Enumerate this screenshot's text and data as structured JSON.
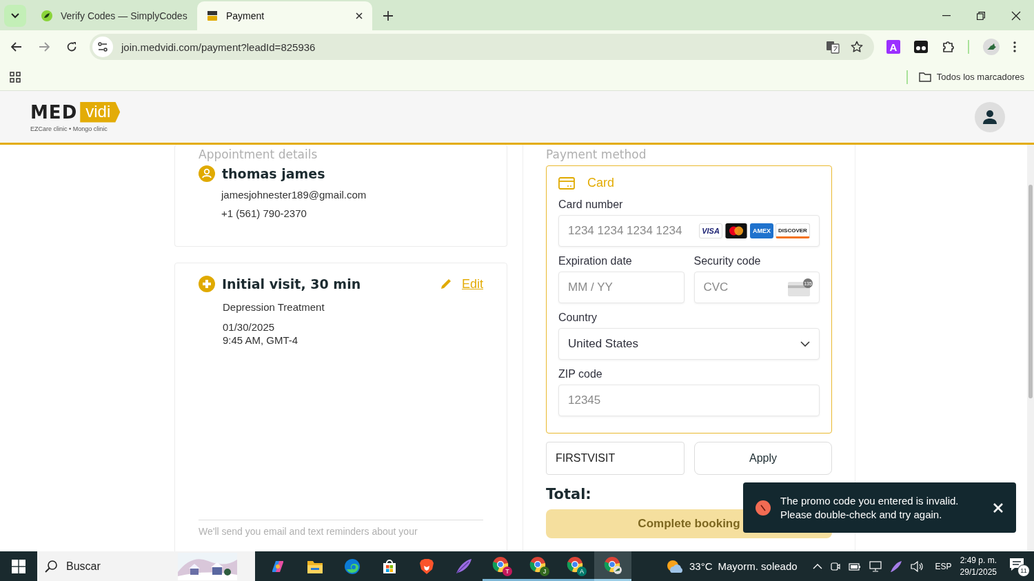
{
  "browser": {
    "tabs": [
      {
        "title": "Verify Codes — SimplyCodes",
        "kind": "simplycodes",
        "selected": false
      },
      {
        "title": "Payment",
        "kind": "medvidi",
        "selected": true
      }
    ],
    "url": "join.medvidi.com/payment?leadId=825936",
    "extension_label": "A",
    "bookmarks_label": "Todos los marcadores"
  },
  "site": {
    "logo_left": "MED",
    "logo_right": "vidi",
    "tagline": "EZCare clinic • Mongo clinic"
  },
  "appointment": {
    "heading": "Appointment details",
    "patient": {
      "name": "thomas james",
      "email": "jamesjohnester189@gmail.com",
      "phone": "+1 (561) 790-2370"
    },
    "visit": {
      "title": "Initial visit, 30 min",
      "edit_label": "Edit",
      "service": "Depression Treatment",
      "date": "01/30/2025",
      "time": "9:45 AM, GMT-4"
    },
    "reminder": "We'll send you email and text reminders about your"
  },
  "payment": {
    "heading": "Payment method",
    "method": {
      "label": "Card",
      "selected": true
    },
    "card_number": {
      "label": "Card number",
      "placeholder": "1234 1234 1234 1234"
    },
    "card_brands": [
      {
        "kind": "visa",
        "label": "VISA"
      },
      {
        "kind": "mastercard"
      },
      {
        "kind": "amex",
        "label": "AMEX"
      },
      {
        "kind": "discover",
        "label": "DISCOVER"
      }
    ],
    "expiration": {
      "label": "Expiration date",
      "placeholder": "MM / YY"
    },
    "security": {
      "label": "Security code",
      "placeholder": "CVC",
      "card_hint": "135"
    },
    "country": {
      "label": "Country",
      "value": "United States"
    },
    "zip": {
      "label": "ZIP code",
      "placeholder": "12345"
    },
    "promo": {
      "value": "FIRSTVISIT",
      "apply_label": "Apply"
    },
    "total_label": "Total:",
    "submit": {
      "label": "Complete booking",
      "disabled": true
    }
  },
  "toast": {
    "message": "The promo code you entered is invalid. Please double-check and try again."
  },
  "taskbar": {
    "search_placeholder": "Buscar",
    "apps": [
      {
        "kind": "copilot",
        "running": false,
        "selected": false
      },
      {
        "kind": "explorer",
        "running": false,
        "selected": false
      },
      {
        "kind": "edge",
        "running": false,
        "selected": false
      },
      {
        "kind": "store",
        "running": false,
        "selected": false
      },
      {
        "kind": "brave",
        "running": false,
        "selected": false
      },
      {
        "kind": "feather",
        "running": false,
        "selected": false
      },
      {
        "kind": "chrome",
        "badge": "T",
        "color": "#c2185b",
        "running": true,
        "selected": false
      },
      {
        "kind": "chrome",
        "badge": "J",
        "color": "#33691e",
        "running": true,
        "selected": false
      },
      {
        "kind": "chrome",
        "badge": "A",
        "color": "#00796b",
        "running": true,
        "selected": false
      },
      {
        "kind": "chrome",
        "running": true,
        "selected": true
      }
    ],
    "temperature": "33°C",
    "weather": "Mayorm. soleado",
    "language": "ESP",
    "time": "2:49 p. m.",
    "date": "29/1/2025",
    "notifications": "11"
  }
}
